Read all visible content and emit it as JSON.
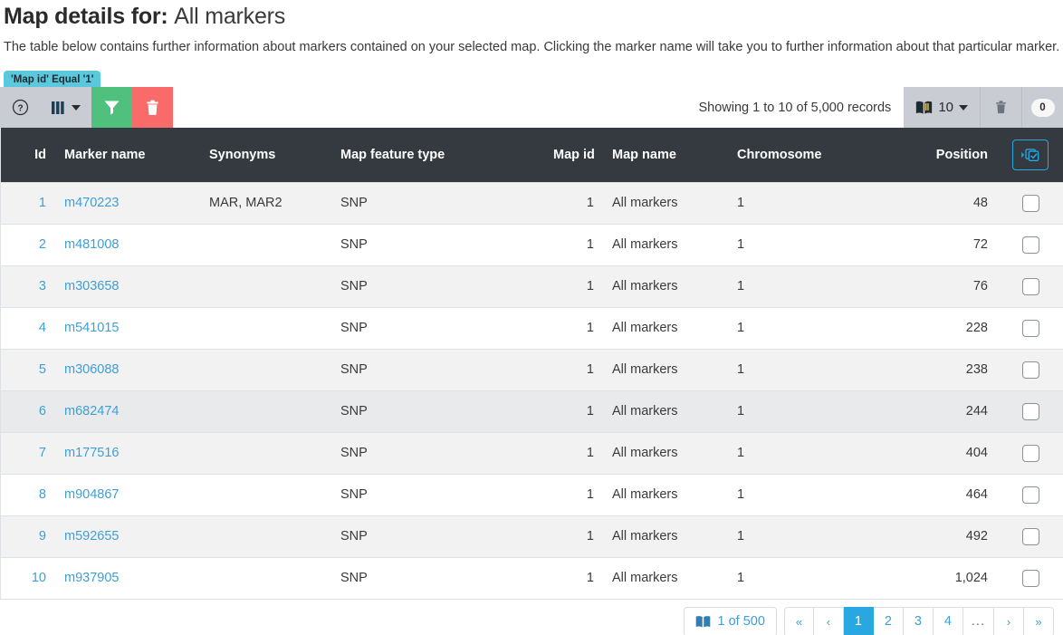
{
  "header": {
    "title_prefix": "Map details for:",
    "title_subject": "All markers",
    "description": "The table below contains further information about markers contained on your selected map. Clicking the marker name will take you to further information about that particular marker."
  },
  "filter": {
    "badge": "'Map id' Equal '1'"
  },
  "toolbar": {
    "help_icon": "question-circle-icon",
    "columns_icon": "columns-icon",
    "filter_icon": "funnel-icon",
    "delete_icon": "trash-icon",
    "records_text": "Showing 1 to 10 of 5,000 records",
    "page_size_icon": "book-icon",
    "page_size_value": "10",
    "clear_icon": "trash-icon",
    "selected_count": "0",
    "green_color": "#50c07e",
    "red_color": "#f96a6a",
    "toolbar_bg": "#c9ccd3"
  },
  "table": {
    "header_bg": "#343a40",
    "accent_color": "#29a7e0",
    "link_color": "#3f9fd4",
    "select_all_icon": "select-all-icon",
    "columns": [
      {
        "key": "id",
        "label": "Id",
        "align": "right"
      },
      {
        "key": "marker_name",
        "label": "Marker name",
        "align": "left"
      },
      {
        "key": "synonyms",
        "label": "Synonyms",
        "align": "left"
      },
      {
        "key": "map_feature_type",
        "label": "Map feature type",
        "align": "left"
      },
      {
        "key": "map_id",
        "label": "Map id",
        "align": "right"
      },
      {
        "key": "map_name",
        "label": "Map name",
        "align": "left"
      },
      {
        "key": "chromosome",
        "label": "Chromosome",
        "align": "left"
      },
      {
        "key": "position",
        "label": "Position",
        "align": "right"
      }
    ],
    "rows": [
      {
        "id": "1",
        "marker_name": "m470223",
        "synonyms": "MAR, MAR2",
        "map_feature_type": "SNP",
        "map_id": "1",
        "map_name": "All markers",
        "chromosome": "1",
        "position": "48"
      },
      {
        "id": "2",
        "marker_name": "m481008",
        "synonyms": "",
        "map_feature_type": "SNP",
        "map_id": "1",
        "map_name": "All markers",
        "chromosome": "1",
        "position": "72"
      },
      {
        "id": "3",
        "marker_name": "m303658",
        "synonyms": "",
        "map_feature_type": "SNP",
        "map_id": "1",
        "map_name": "All markers",
        "chromosome": "1",
        "position": "76"
      },
      {
        "id": "4",
        "marker_name": "m541015",
        "synonyms": "",
        "map_feature_type": "SNP",
        "map_id": "1",
        "map_name": "All markers",
        "chromosome": "1",
        "position": "228"
      },
      {
        "id": "5",
        "marker_name": "m306088",
        "synonyms": "",
        "map_feature_type": "SNP",
        "map_id": "1",
        "map_name": "All markers",
        "chromosome": "1",
        "position": "238"
      },
      {
        "id": "6",
        "marker_name": "m682474",
        "synonyms": "",
        "map_feature_type": "SNP",
        "map_id": "1",
        "map_name": "All markers",
        "chromosome": "1",
        "position": "244"
      },
      {
        "id": "7",
        "marker_name": "m177516",
        "synonyms": "",
        "map_feature_type": "SNP",
        "map_id": "1",
        "map_name": "All markers",
        "chromosome": "1",
        "position": "404"
      },
      {
        "id": "8",
        "marker_name": "m904867",
        "synonyms": "",
        "map_feature_type": "SNP",
        "map_id": "1",
        "map_name": "All markers",
        "chromosome": "1",
        "position": "464"
      },
      {
        "id": "9",
        "marker_name": "m592655",
        "synonyms": "",
        "map_feature_type": "SNP",
        "map_id": "1",
        "map_name": "All markers",
        "chromosome": "1",
        "position": "492"
      },
      {
        "id": "10",
        "marker_name": "m937905",
        "synonyms": "",
        "map_feature_type": "SNP",
        "map_id": "1",
        "map_name": "All markers",
        "chromosome": "1",
        "position": "1,024"
      }
    ]
  },
  "pagination": {
    "info_icon": "book-icon",
    "info_text": "1 of 500",
    "first_label": "«",
    "prev_label": "‹",
    "pages": [
      "1",
      "2",
      "3",
      "4"
    ],
    "active_page": "1",
    "ellipsis": "...",
    "next_label": "›",
    "last_label": "»"
  }
}
